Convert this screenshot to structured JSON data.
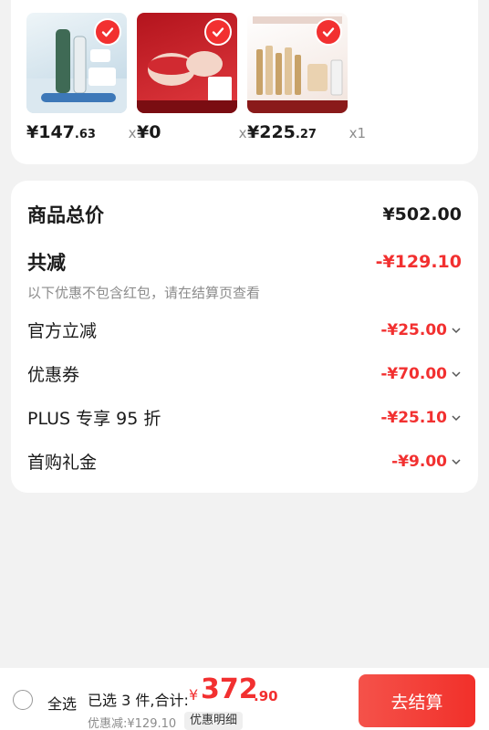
{
  "products": [
    {
      "price_main": "¥147",
      "price_cents": ".63",
      "qty": "x1",
      "colors": {
        "bg1": "#e8f1f6",
        "bg2": "#c9dcea",
        "accent": "#3f6a55"
      }
    },
    {
      "price_main": "¥0",
      "price_cents": "",
      "qty": "x1",
      "colors": {
        "bg1": "#b3141d",
        "bg2": "#e23a3f",
        "accent": "#f5d8c7"
      }
    },
    {
      "price_main": "¥225",
      "price_cents": ".27",
      "qty": "x1",
      "colors": {
        "bg1": "#ffffff",
        "bg2": "#f2e6df",
        "accent": "#c8a268"
      }
    }
  ],
  "summary": {
    "goods_total_label": "商品总价",
    "goods_total_value": "¥502.00",
    "total_discount_label": "共减",
    "total_discount_value": "-¥129.10",
    "note": "以下优惠不包含红包，请在结算页查看",
    "items": [
      {
        "label": "官方立减",
        "value": "-¥25.00"
      },
      {
        "label": "优惠券",
        "value": "-¥70.00"
      },
      {
        "label": "PLUS 专享 95 折",
        "value": "-¥25.10"
      },
      {
        "label": "首购礼金",
        "value": "-¥9.00"
      }
    ]
  },
  "bottom": {
    "select_all": "全选",
    "selected_count": "已选 3 件,合计:",
    "currency": "¥",
    "total_int": "372",
    "total_dec": ".90",
    "discount_text": "优惠减:¥129.10",
    "detail_label": "优惠明细",
    "checkout_label": "去结算"
  },
  "colors": {
    "accent_red": "#f23030",
    "muted": "#8c8c8c"
  }
}
